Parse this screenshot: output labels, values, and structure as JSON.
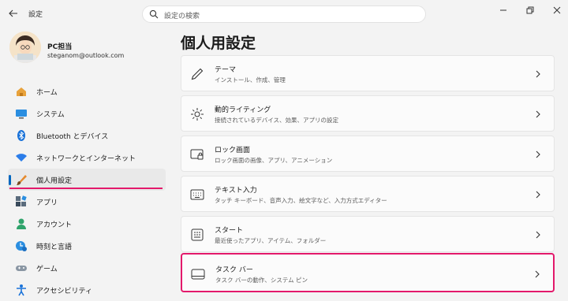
{
  "titlebar": {
    "app_title": "設定",
    "search_placeholder": "設定の検索"
  },
  "profile": {
    "name": "PC担当",
    "email": "steganom@outlook.com"
  },
  "sidebar": {
    "items": [
      {
        "label": "ホーム",
        "icon": "home-icon"
      },
      {
        "label": "システム",
        "icon": "system-icon"
      },
      {
        "label": "Bluetooth とデバイス",
        "icon": "bluetooth-icon"
      },
      {
        "label": "ネットワークとインターネット",
        "icon": "wifi-icon"
      },
      {
        "label": "個人用設定",
        "icon": "brush-icon",
        "selected": true
      },
      {
        "label": "アプリ",
        "icon": "apps-icon"
      },
      {
        "label": "アカウント",
        "icon": "account-icon"
      },
      {
        "label": "時刻と言語",
        "icon": "time-language-icon"
      },
      {
        "label": "ゲーム",
        "icon": "gamepad-icon"
      },
      {
        "label": "アクセシビリティ",
        "icon": "accessibility-icon"
      }
    ]
  },
  "main": {
    "title": "個人用設定",
    "cards": [
      {
        "title": "テーマ",
        "subtitle": "インストール、作成、管理",
        "icon": "pen-icon"
      },
      {
        "title": "動的ライティング",
        "subtitle": "接続されているデバイス、効果、アプリの設定",
        "icon": "lighting-icon"
      },
      {
        "title": "ロック画面",
        "subtitle": "ロック画面の画像、アプリ、アニメーション",
        "icon": "lock-screen-icon"
      },
      {
        "title": "テキスト入力",
        "subtitle": "タッチ キーボード、音声入力、絵文字など、入力方式エディター",
        "icon": "keyboard-icon"
      },
      {
        "title": "スタート",
        "subtitle": "最近使ったアプリ、アイテム、フォルダー",
        "icon": "start-icon"
      },
      {
        "title": "タスク バー",
        "subtitle": "タスク バーの動作、システム ピン",
        "icon": "taskbar-icon",
        "highlighted": true
      }
    ]
  },
  "colors": {
    "accent": "#0067c0",
    "highlight": "#e3196b",
    "background": "#f3f3f3",
    "card": "#fbfbfb"
  }
}
